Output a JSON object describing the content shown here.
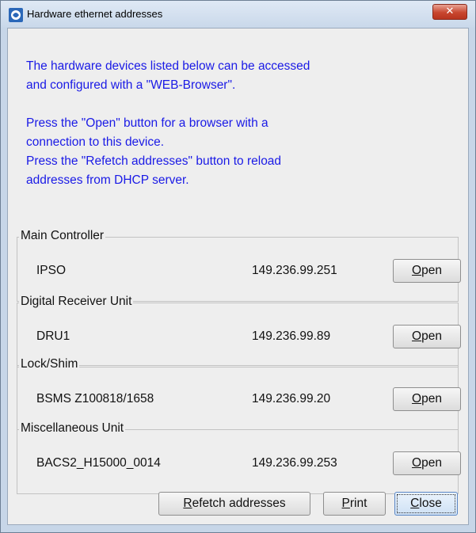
{
  "window": {
    "title": "Hardware ethernet addresses",
    "close_glyph": "✕"
  },
  "info": {
    "lines": [
      "The hardware devices listed below can be accessed",
      "and configured with a \"WEB-Browser\".",
      "",
      "Press the \"Open\" button for a browser with a",
      "connection to this device.",
      "Press the \"Refetch addresses\" button to reload",
      "addresses from DHCP server."
    ]
  },
  "groups": [
    {
      "title": "Main Controller",
      "device": "IPSO",
      "ip": "149.236.99.251",
      "button": {
        "mnemonic": "O",
        "rest": "pen"
      }
    },
    {
      "title": "Digital Receiver Unit",
      "device": "DRU1",
      "ip": "149.236.99.89",
      "button": {
        "mnemonic": "O",
        "rest": "pen"
      }
    },
    {
      "title": "Lock/Shim",
      "device": "BSMS Z100818/1658",
      "ip": "149.236.99.20",
      "button": {
        "mnemonic": "O",
        "rest": "pen"
      }
    },
    {
      "title": "Miscellaneous Unit",
      "device": "BACS2_H15000_0014",
      "ip": "149.236.99.253",
      "button": {
        "mnemonic": "O",
        "rest": "pen"
      }
    }
  ],
  "footer": {
    "refetch": {
      "mnemonic": "R",
      "rest": "efetch addresses"
    },
    "print": {
      "mnemonic": "P",
      "rest": "rint"
    },
    "close": {
      "mnemonic": "C",
      "rest": "lose"
    }
  },
  "colors": {
    "info_text": "#1a1ae6",
    "close_button": "#c8462f"
  },
  "icons": {
    "title_icon": "app-logo-icon",
    "close_icon": "close-icon"
  }
}
